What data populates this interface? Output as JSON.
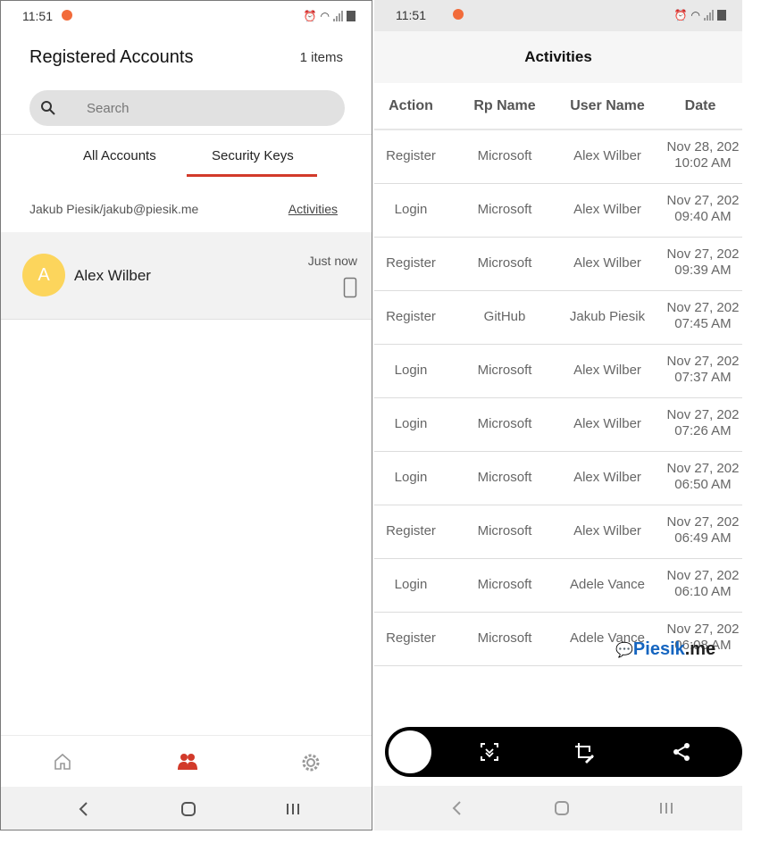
{
  "left": {
    "status": {
      "time": "11:51"
    },
    "title": "Registered Accounts",
    "count": "1 items",
    "search": {
      "placeholder": "Search"
    },
    "tabs": [
      {
        "label": "All Accounts"
      },
      {
        "label": "Security Keys"
      }
    ],
    "owner": "Jakub Piesik/jakub@piesik.me",
    "activities_link": "Activities",
    "account": {
      "initial": "A",
      "name": "Alex Wilber",
      "time": "Just now"
    },
    "nav": [
      "home-icon",
      "accounts-icon",
      "settings-icon"
    ],
    "colors": {
      "accent": "#d23a2a",
      "avatar": "#fcd55c"
    }
  },
  "right": {
    "status": {
      "time": "11:51"
    },
    "header": "Activities",
    "columns": [
      "Action",
      "Rp Name",
      "User Name",
      "Date"
    ],
    "rows": [
      {
        "action": "Register",
        "rp": "Microsoft",
        "user": "Alex Wilber",
        "date": "Nov 28, 202\n10:02 AM"
      },
      {
        "action": "Login",
        "rp": "Microsoft",
        "user": "Alex Wilber",
        "date": "Nov 27, 202\n09:40 AM"
      },
      {
        "action": "Register",
        "rp": "Microsoft",
        "user": "Alex Wilber",
        "date": "Nov 27, 202\n09:39 AM"
      },
      {
        "action": "Register",
        "rp": "GitHub",
        "user": "Jakub Piesik",
        "date": "Nov 27, 202\n07:45 AM"
      },
      {
        "action": "Login",
        "rp": "Microsoft",
        "user": "Alex Wilber",
        "date": "Nov 27, 202\n07:37 AM"
      },
      {
        "action": "Login",
        "rp": "Microsoft",
        "user": "Alex Wilber",
        "date": "Nov 27, 202\n07:26 AM"
      },
      {
        "action": "Login",
        "rp": "Microsoft",
        "user": "Alex Wilber",
        "date": "Nov 27, 202\n06:50 AM"
      },
      {
        "action": "Register",
        "rp": "Microsoft",
        "user": "Alex Wilber",
        "date": "Nov 27, 202\n06:49 AM"
      },
      {
        "action": "Login",
        "rp": "Microsoft",
        "user": "Adele Vance",
        "date": "Nov 27, 202\n06:10 AM"
      },
      {
        "action": "Register",
        "rp": "Microsoft",
        "user": "Adele Vance",
        "date": "Nov 27, 202\n06:08 AM"
      }
    ],
    "watermark": {
      "brand": "Piesik",
      "suffix": ".me"
    },
    "toolbar": [
      "scroll-capture-icon",
      "crop-edit-icon",
      "share-icon"
    ]
  }
}
